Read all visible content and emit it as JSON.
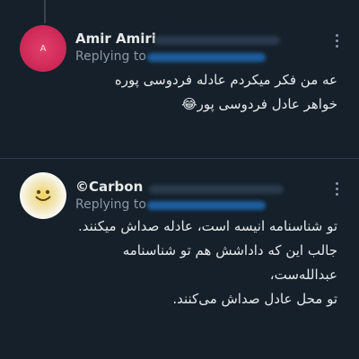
{
  "tweets": [
    {
      "name": "Amir Amiri",
      "avatar_letter": "A",
      "replying_label": "Replying to",
      "body": "عه من فکر میکردم عادله فردوسی پوره\nخواهر عادل فردوسی پور😂"
    },
    {
      "name": "©Carbon",
      "replying_label": "Replying to",
      "body": "تو شناسنامه انیسه است، عادله صداش میکنند.\nجالب این که داداشش هم تو شناسنامه عبدالله‌ست،\nتو محل عادل صداش می‌کنند."
    }
  ],
  "colors": {
    "background": "#15202b",
    "text": "#e7e9ea",
    "secondary": "#8b98a5",
    "link": "#1d9bf0"
  }
}
